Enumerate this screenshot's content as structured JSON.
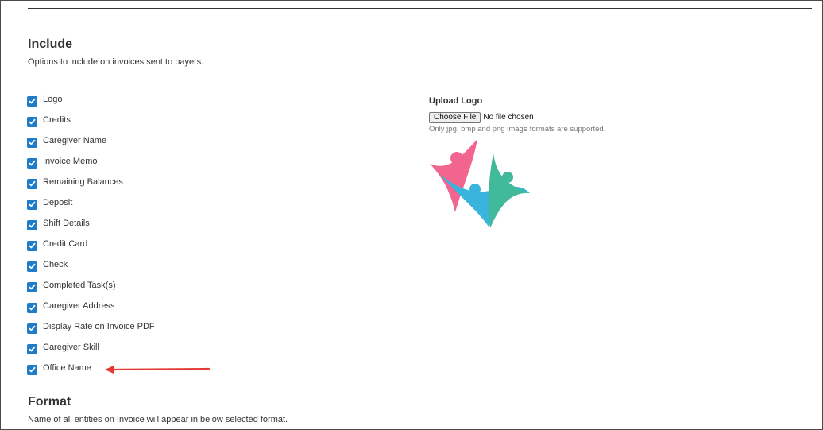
{
  "include": {
    "title": "Include",
    "description": "Options to include on invoices sent to payers.",
    "options": [
      {
        "label": "Logo",
        "checked": true
      },
      {
        "label": "Credits",
        "checked": true
      },
      {
        "label": "Caregiver Name",
        "checked": true
      },
      {
        "label": "Invoice Memo",
        "checked": true
      },
      {
        "label": "Remaining Balances",
        "checked": true
      },
      {
        "label": "Deposit",
        "checked": true
      },
      {
        "label": "Shift Details",
        "checked": true
      },
      {
        "label": "Credit Card",
        "checked": true
      },
      {
        "label": "Check",
        "checked": true
      },
      {
        "label": "Completed Task(s)",
        "checked": true
      },
      {
        "label": "Caregiver Address",
        "checked": true
      },
      {
        "label": "Display Rate on Invoice PDF",
        "checked": true
      },
      {
        "label": "Caregiver Skill",
        "checked": true
      },
      {
        "label": "Office Name",
        "checked": true
      }
    ]
  },
  "upload": {
    "label": "Upload Logo",
    "button_label": "Choose File",
    "file_status": "No file chosen",
    "hint": "Only jpg, bmp and png image formats are supported."
  },
  "format": {
    "title": "Format",
    "description": "Name of all entities on Invoice will appear in below selected format."
  },
  "colors": {
    "checkbox": "#1f7cc9",
    "arrow": "#e53935",
    "logo_pink": "#ef4b7c",
    "logo_blue": "#16a7d8",
    "logo_green": "#1fae8a"
  },
  "icons": {
    "checkbox": "checkmark-icon",
    "annotation": "red-arrow-icon",
    "logo": "people-logo-icon"
  }
}
